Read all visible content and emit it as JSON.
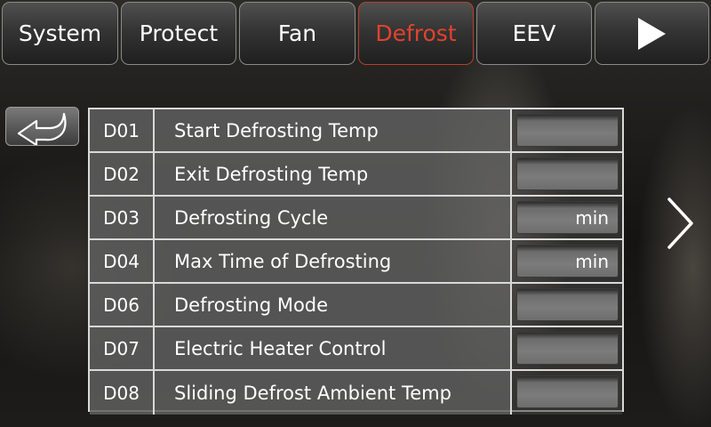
{
  "tabs": [
    {
      "label": "System",
      "active": false
    },
    {
      "label": "Protect",
      "active": false
    },
    {
      "label": "Fan",
      "active": false
    },
    {
      "label": "Defrost",
      "active": true
    },
    {
      "label": "EEV",
      "active": false
    }
  ],
  "tab_next_icon": "play-icon",
  "back_icon": "return-arrow-icon",
  "page_next_icon": "chevron-right-icon",
  "accent_color": "#e0432d",
  "rows": [
    {
      "code": "D01",
      "name": "Start Defrosting Temp",
      "unit": ""
    },
    {
      "code": "D02",
      "name": "Exit Defrosting Temp",
      "unit": ""
    },
    {
      "code": "D03",
      "name": "Defrosting Cycle",
      "unit": "min"
    },
    {
      "code": "D04",
      "name": "Max Time of Defrosting",
      "unit": "min"
    },
    {
      "code": "D06",
      "name": "Defrosting Mode",
      "unit": ""
    },
    {
      "code": "D07",
      "name": "Electric Heater Control",
      "unit": ""
    },
    {
      "code": "D08",
      "name": "Sliding Defrost Ambient Temp",
      "unit": ""
    }
  ]
}
